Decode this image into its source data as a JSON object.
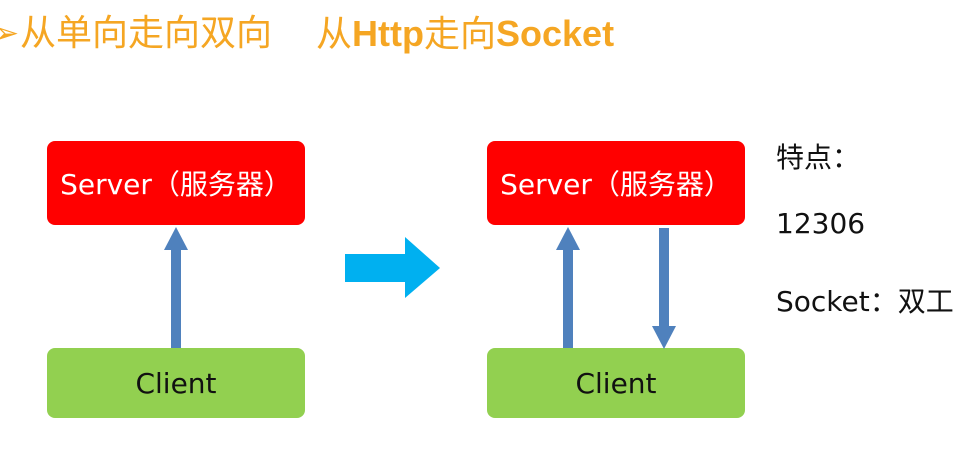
{
  "title": {
    "bullet": "➢",
    "part1": "从单向走向双向",
    "part2_prefix": "从",
    "part2_http": "Http",
    "part2_mid": "走向",
    "part2_socket": "Socket"
  },
  "left_diagram": {
    "server_label": "Server（服务器）",
    "client_label": "Client"
  },
  "right_diagram": {
    "server_label": "Server（服务器）",
    "client_label": "Client"
  },
  "notes": {
    "heading": "特点：",
    "example": "12306",
    "socket_line": "Socket：双工"
  },
  "colors": {
    "title": "#f5a623",
    "server": "#ff0000",
    "client": "#92d050",
    "connector_arrow": "#4f81bd",
    "transition_arrow": "#00b0f0"
  }
}
